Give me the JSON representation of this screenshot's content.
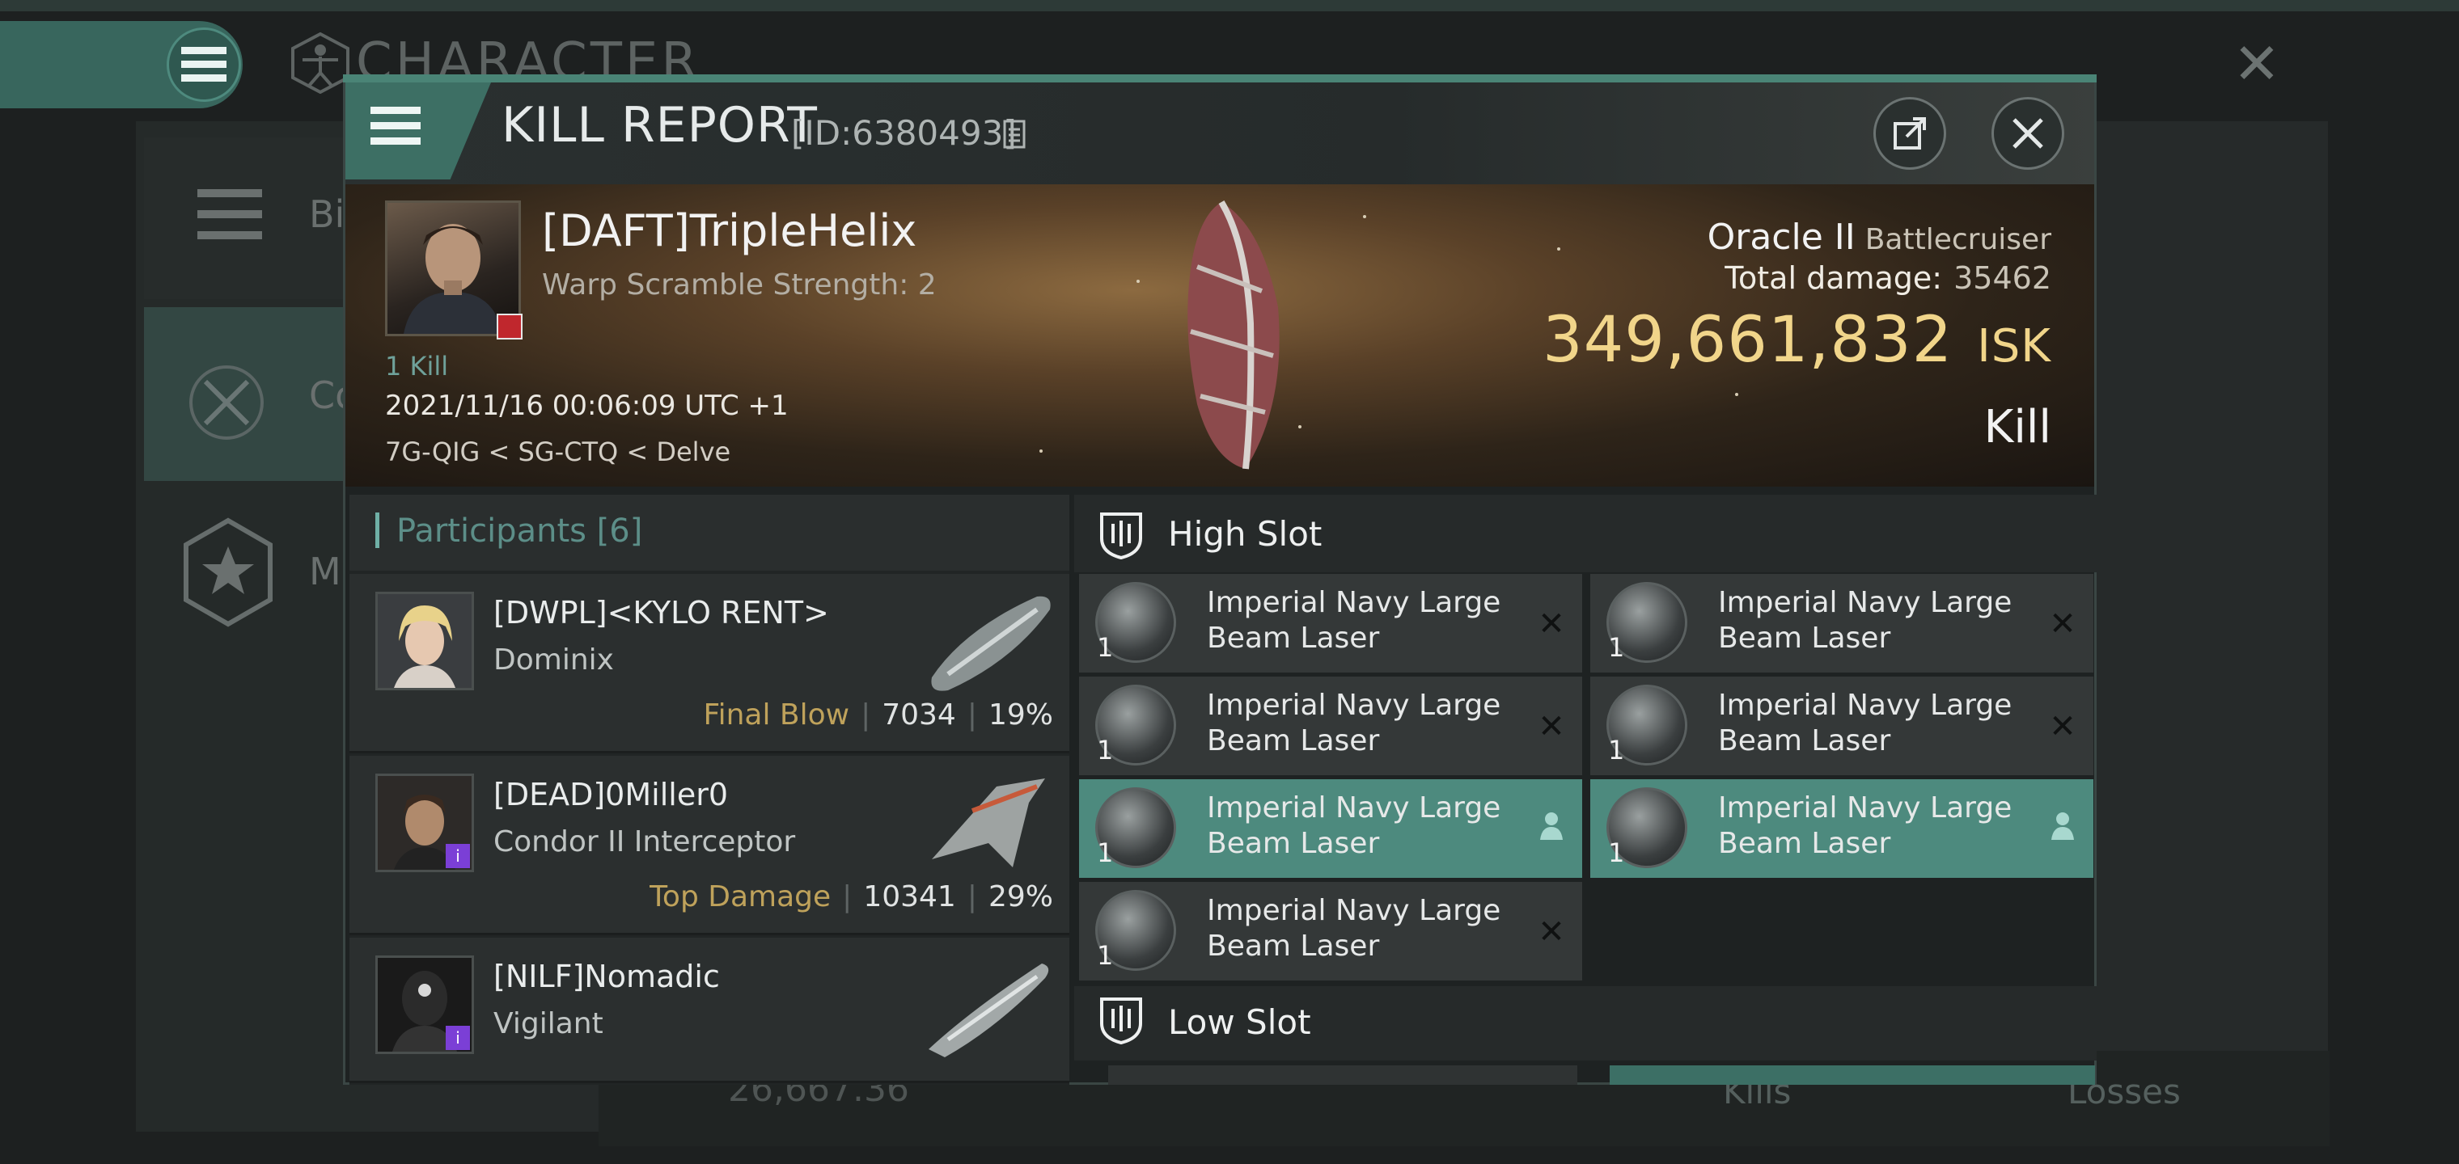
{
  "background": {
    "title": "CHARACTER",
    "sidebar": [
      {
        "label": "Bi"
      },
      {
        "label": "Co"
      },
      {
        "label": "Mi"
      }
    ],
    "bottom": {
      "value": "26,667.36",
      "kills_label": "Kills",
      "losses_label": "Losses"
    }
  },
  "dialog": {
    "title": "KILL REPORT",
    "id": "[ID:6380493]"
  },
  "victim": {
    "name": "[DAFT]TripleHelix",
    "warp": "Warp Scramble Strength: 2",
    "kills": "1 Kill",
    "timestamp": "2021/11/16 00:06:09 UTC +1",
    "location": "7G-QIG < SG-CTQ < Delve",
    "ship": "Oracle II",
    "ship_class": "Battlecruiser",
    "total_damage_label": "Total damage:",
    "total_damage": "35462",
    "isk_value": "349,661,832",
    "isk_unit": "ISK",
    "result": "Kill"
  },
  "participants": {
    "label": "Participants [6]",
    "items": [
      {
        "name": "[DWPL]<KYLO RENT>",
        "ship": "Dominix",
        "tag": "Final Blow",
        "damage": "7034",
        "percent": "19%",
        "badge": ""
      },
      {
        "name": "[DEAD]0Miller0",
        "ship": "Condor II Interceptor",
        "tag": "Top Damage",
        "damage": "10341",
        "percent": "29%",
        "badge": "i"
      },
      {
        "name": "[NILF]Nomadic",
        "ship": "Vigilant",
        "tag": "",
        "damage": "",
        "percent": "",
        "badge": "i"
      }
    ]
  },
  "high_slot": {
    "label": "High Slot",
    "modules": [
      {
        "name": "Imperial Navy Large Beam Laser",
        "qty": "1",
        "state": "destroyed"
      },
      {
        "name": "Imperial Navy Large Beam Laser",
        "qty": "1",
        "state": "destroyed"
      },
      {
        "name": "Imperial Navy Large Beam Laser",
        "qty": "1",
        "state": "destroyed"
      },
      {
        "name": "Imperial Navy Large Beam Laser",
        "qty": "1",
        "state": "destroyed"
      },
      {
        "name": "Imperial Navy Large Beam Laser",
        "qty": "1",
        "state": "dropped"
      },
      {
        "name": "Imperial Navy Large Beam Laser",
        "qty": "1",
        "state": "dropped"
      },
      {
        "name": "Imperial Navy Large Beam Laser",
        "qty": "1",
        "state": "destroyed"
      }
    ]
  },
  "low_slot": {
    "label": "Low Slot"
  },
  "colors": {
    "accent": "#4d8a7e",
    "isk": "#f1d58a",
    "final_blow": "#bfa25b"
  }
}
